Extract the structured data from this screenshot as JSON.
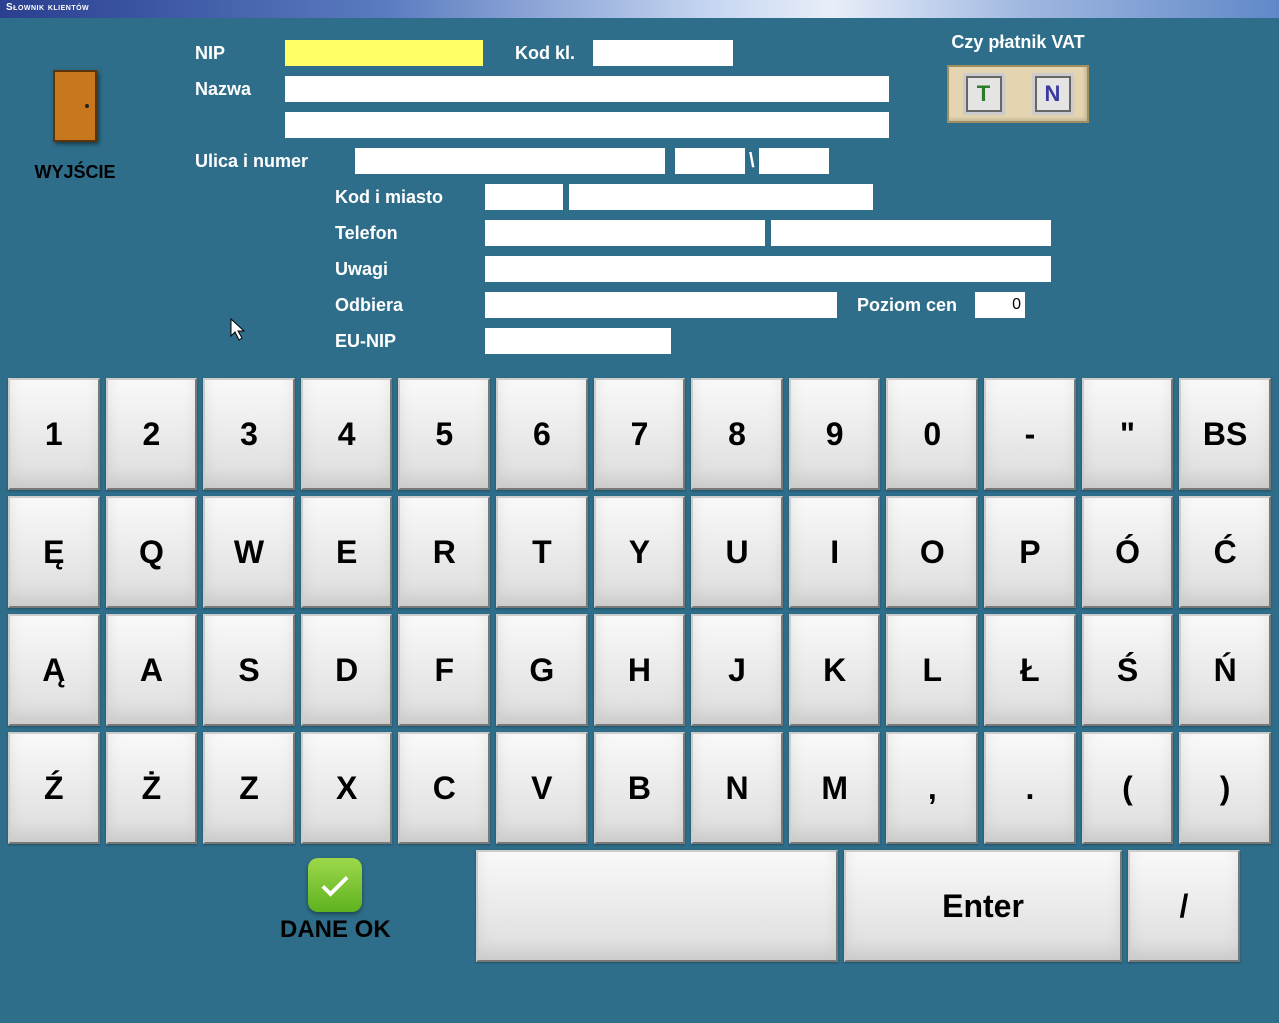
{
  "window": {
    "title": "Słownik klientów"
  },
  "exit": {
    "label": "WYJŚCIE"
  },
  "vat": {
    "label": "Czy płatnik VAT",
    "yes": "T",
    "no": "N"
  },
  "form": {
    "nip": {
      "label": "NIP",
      "value": ""
    },
    "kodkl": {
      "label": "Kod kl.",
      "value": ""
    },
    "nazwa": {
      "label": "Nazwa",
      "value1": "",
      "value2": ""
    },
    "ulica": {
      "label": "Ulica i numer",
      "street": "",
      "nr1": "",
      "sep": "\\",
      "nr2": ""
    },
    "kodmiasto": {
      "label": "Kod i miasto",
      "kod": "",
      "miasto": ""
    },
    "telefon": {
      "label": "Telefon",
      "tel1": "",
      "tel2": ""
    },
    "uwagi": {
      "label": "Uwagi",
      "value": ""
    },
    "odbiera": {
      "label": "Odbiera",
      "value": ""
    },
    "poziom": {
      "label": "Poziom cen",
      "value": "0"
    },
    "eunip": {
      "label": "EU-NIP",
      "value": ""
    }
  },
  "keyboard": {
    "row1": [
      "1",
      "2",
      "3",
      "4",
      "5",
      "6",
      "7",
      "8",
      "9",
      "0",
      "-",
      "\"",
      "BS"
    ],
    "row2": [
      "Ę",
      "Q",
      "W",
      "E",
      "R",
      "T",
      "Y",
      "U",
      "I",
      "O",
      "P",
      "Ó",
      "Ć"
    ],
    "row3": [
      "Ą",
      "A",
      "S",
      "D",
      "F",
      "G",
      "H",
      "J",
      "K",
      "L",
      "Ł",
      "Ś",
      "Ń"
    ],
    "row4": [
      "Ź",
      "Ż",
      "Z",
      "X",
      "C",
      "V",
      "B",
      "N",
      "M",
      ",",
      ".",
      "(",
      ")"
    ],
    "enter": "Enter",
    "slash": "/"
  },
  "confirm": {
    "label": "DANE OK"
  }
}
